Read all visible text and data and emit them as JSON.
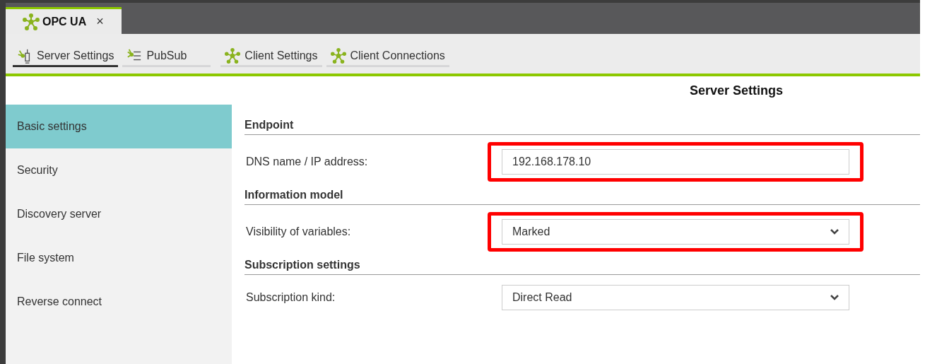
{
  "window_tabs": [
    {
      "label": "OPC UA",
      "close": "×",
      "selected": true
    }
  ],
  "toolbar_tabs": [
    {
      "label": "Server Settings",
      "kind": "server",
      "selected": true
    },
    {
      "label": "PubSub",
      "kind": "pubsub",
      "selected": false
    },
    {
      "label": "Client Settings",
      "kind": "network",
      "selected": false
    },
    {
      "label": "Client Connections",
      "kind": "network",
      "selected": false
    }
  ],
  "page_title": "Server Settings",
  "sidebar": {
    "items": [
      {
        "label": "Basic settings",
        "selected": true
      },
      {
        "label": "Security",
        "selected": false
      },
      {
        "label": "Discovery server",
        "selected": false
      },
      {
        "label": "File system",
        "selected": false
      },
      {
        "label": "Reverse connect",
        "selected": false
      }
    ]
  },
  "sections": [
    {
      "title": "Endpoint",
      "fields": [
        {
          "label": "DNS name / IP address:",
          "kind": "text",
          "value": "192.168.178.10",
          "highlighted": true
        }
      ]
    },
    {
      "title": "Information model",
      "fields": [
        {
          "label": "Visibility of variables:",
          "kind": "select",
          "value": "Marked",
          "highlighted": true
        }
      ]
    },
    {
      "title": "Subscription settings",
      "fields": [
        {
          "label": "Subscription kind:",
          "kind": "select",
          "value": "Direct Read",
          "highlighted": false
        }
      ]
    }
  ]
}
